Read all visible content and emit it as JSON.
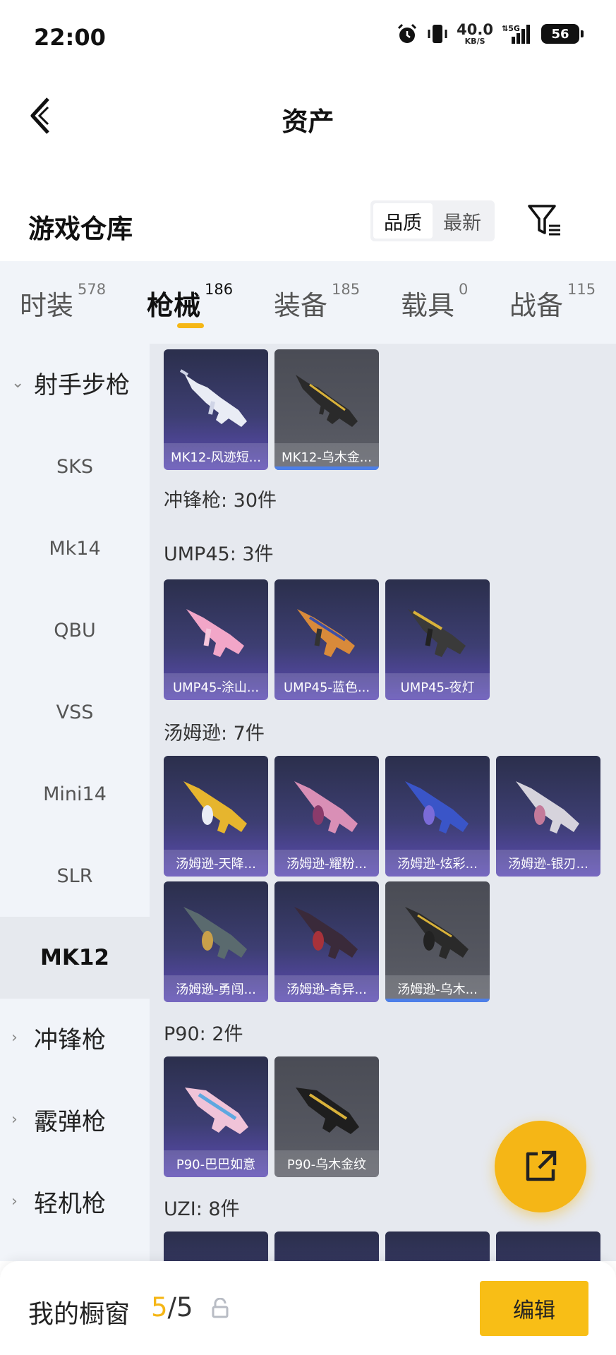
{
  "status_bar": {
    "time": "22:00",
    "net_speed": "40.0",
    "net_unit": "KB/S",
    "signal": "5G",
    "battery": "56"
  },
  "header": {
    "title": "资产"
  },
  "warehouse": {
    "title": "游戏仓库",
    "sort": [
      "品质",
      "最新"
    ]
  },
  "tabs": [
    {
      "label": "时装",
      "count": "578"
    },
    {
      "label": "枪械",
      "count": "186"
    },
    {
      "label": "装备",
      "count": "185"
    },
    {
      "label": "载具",
      "count": "0"
    },
    {
      "label": "战备",
      "count": "115"
    }
  ],
  "sidebar": {
    "group_open": "射手步枪",
    "items": [
      "SKS",
      "Mk14",
      "QBU",
      "VSS",
      "Mini14",
      "SLR",
      "MK12"
    ],
    "groups": [
      "冲锋枪",
      "霰弹枪",
      "轻机枪"
    ]
  },
  "content": {
    "mk12_items": [
      "MK12-风迹短...",
      "MK12-乌木金..."
    ],
    "smg_title": "冲锋枪: 30件",
    "ump_title": "UMP45: 3件",
    "ump_items": [
      "UMP45-涂山...",
      "UMP45-蓝色...",
      "UMP45-夜灯"
    ],
    "tommy_title": "汤姆逊: 7件",
    "tommy_items": [
      "汤姆逊-天降...",
      "汤姆逊-耀粉...",
      "汤姆逊-炫彩...",
      "汤姆逊-银刃...",
      "汤姆逊-勇闯...",
      "汤姆逊-奇异...",
      "汤姆逊-乌木..."
    ],
    "p90_title": "P90: 2件",
    "p90_items": [
      "P90-巴巴如意",
      "P90-乌木金纹"
    ],
    "uzi_title": "UZI: 8件"
  },
  "bottom": {
    "label": "我的橱窗",
    "current": "5",
    "total": "/5",
    "edit": "编辑"
  },
  "colors": {
    "accent": "#f5b616",
    "card_purple": "#3d3e72",
    "card_gray": "#54565f",
    "equipped_bar": "#4d7fe8"
  }
}
